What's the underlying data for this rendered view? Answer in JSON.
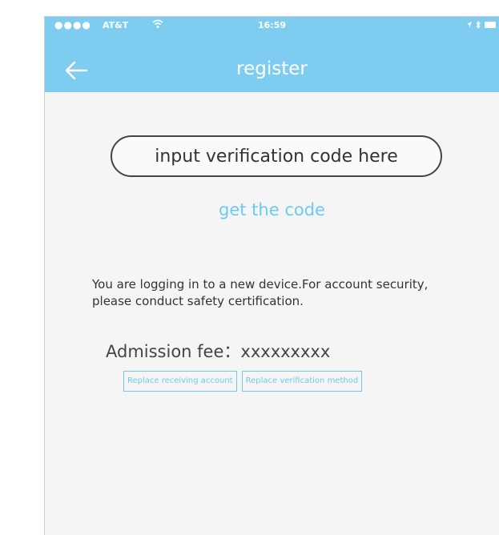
{
  "status_bar": {
    "signal": "●●●●",
    "carrier": "AT&T",
    "time": "16:59"
  },
  "header": {
    "title": "register",
    "back_icon": "arrow-left-icon"
  },
  "verification": {
    "placeholder": "input verification code here",
    "get_code_label": "get the code"
  },
  "message": {
    "text": "You are logging in to a new device.For account security,\nplease conduct safety certification."
  },
  "fee": {
    "label": "Admission fee",
    "separator": "：",
    "value": "xxxxxxxxx"
  },
  "actions": {
    "replace_account_label": "Replace receiving account",
    "replace_method_label": "Replace verification method"
  },
  "colors": {
    "accent": "#7ecdf1",
    "link": "#6ccbf0",
    "background": "#f5f5f5"
  }
}
